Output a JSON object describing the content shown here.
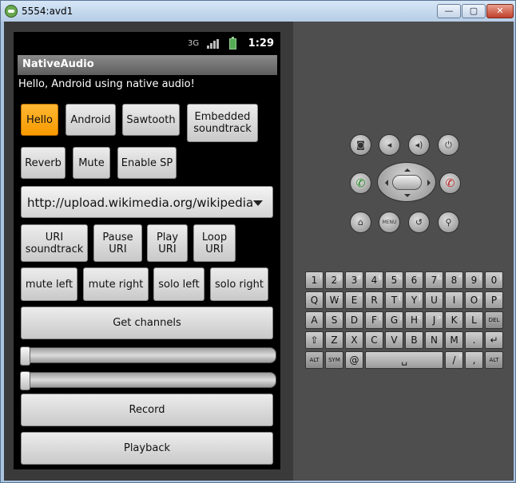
{
  "window": {
    "title": "5554:avd1",
    "minimize_label": "—",
    "maximize_label": "▢",
    "close_label": "✕"
  },
  "statusbar": {
    "data_label": "3G",
    "clock": "1:29"
  },
  "app": {
    "title": "NativeAudio",
    "hello": "Hello, Android using native audio!"
  },
  "buttons": {
    "hello": "Hello",
    "android": "Android",
    "sawtooth": "Sawtooth",
    "embedded": "Embedded soundtrack",
    "reverb": "Reverb",
    "mute": "Mute",
    "enable_sp": "Enable SP",
    "uri_soundtrack": "URI soundtrack",
    "pause_uri": "Pause URI",
    "play_uri": "Play URI",
    "loop_uri": "Loop URI",
    "mute_left": "mute left",
    "mute_right": "mute right",
    "solo_left": "solo left",
    "solo_right": "solo right",
    "get_channels": "Get channels",
    "record": "Record",
    "playback": "Playback"
  },
  "spinner": {
    "value": "http://upload.wikimedia.org/wikipedia"
  },
  "sliders": [
    {
      "value": 0
    },
    {
      "value": 0
    }
  ],
  "controls": {
    "menu_label": "MENU"
  },
  "keyboard": {
    "rows": [
      [
        {
          "k": "1",
          "a": "!"
        },
        {
          "k": "2",
          "a": "@"
        },
        {
          "k": "3",
          "a": "#"
        },
        {
          "k": "4",
          "a": "$"
        },
        {
          "k": "5",
          "a": "%"
        },
        {
          "k": "6",
          "a": "^"
        },
        {
          "k": "7",
          "a": "&"
        },
        {
          "k": "8",
          "a": "*"
        },
        {
          "k": "9",
          "a": "("
        },
        {
          "k": "0",
          "a": ")"
        }
      ],
      [
        {
          "k": "Q",
          "a": "`"
        },
        {
          "k": "W",
          "a": "~"
        },
        {
          "k": "E",
          "a": "\""
        },
        {
          "k": "R",
          "a": ""
        },
        {
          "k": "T",
          "a": "{"
        },
        {
          "k": "Y",
          "a": "}"
        },
        {
          "k": "U",
          "a": "-"
        },
        {
          "k": "I",
          "a": ""
        },
        {
          "k": "O",
          "a": "+"
        },
        {
          "k": "P",
          "a": "="
        }
      ],
      [
        {
          "k": "A",
          "a": ""
        },
        {
          "k": "S",
          "a": "\\"
        },
        {
          "k": "D",
          "a": ""
        },
        {
          "k": "F",
          "a": "["
        },
        {
          "k": "G",
          "a": "]"
        },
        {
          "k": "H",
          "a": "<"
        },
        {
          "k": "J",
          "a": ">"
        },
        {
          "k": "K",
          "a": ";"
        },
        {
          "k": "L",
          "a": ":"
        },
        {
          "k": "DEL",
          "a": ""
        }
      ],
      [
        {
          "k": "⇧",
          "a": ""
        },
        {
          "k": "Z",
          "a": ""
        },
        {
          "k": "X",
          "a": ""
        },
        {
          "k": "C",
          "a": ""
        },
        {
          "k": "V",
          "a": ""
        },
        {
          "k": "B",
          "a": ""
        },
        {
          "k": "N",
          "a": ""
        },
        {
          "k": "M",
          "a": ""
        },
        {
          "k": ".",
          "a": ""
        },
        {
          "k": "↵",
          "a": ""
        }
      ],
      [
        {
          "k": "ALT",
          "a": ""
        },
        {
          "k": "SYM",
          "a": ""
        },
        {
          "k": "@",
          "a": ""
        },
        {
          "k": "␣",
          "a": ""
        },
        {
          "k": "/",
          "a": "?"
        },
        {
          "k": ",",
          "a": ""
        },
        {
          "k": "ALT",
          "a": ""
        }
      ]
    ]
  }
}
